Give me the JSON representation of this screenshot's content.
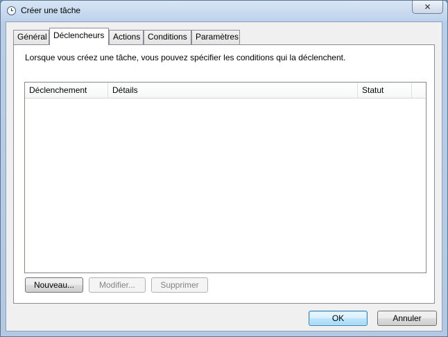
{
  "window": {
    "title": "Créer une tâche",
    "close_symbol": "✕"
  },
  "tabs": [
    {
      "label": "Général"
    },
    {
      "label": "Déclencheurs"
    },
    {
      "label": "Actions"
    },
    {
      "label": "Conditions"
    },
    {
      "label": "Paramètres"
    }
  ],
  "active_tab": "Déclencheurs",
  "triggers_panel": {
    "description": "Lorsque vous créez une tâche, vous pouvez spécifier les conditions qui la déclenchent.",
    "columns": [
      "Déclenchement",
      "Détails",
      "Statut"
    ],
    "rows": [],
    "buttons": {
      "new": "Nouveau...",
      "edit": "Modifier...",
      "delete": "Supprimer"
    }
  },
  "dialog_buttons": {
    "ok": "OK",
    "cancel": "Annuler"
  }
}
